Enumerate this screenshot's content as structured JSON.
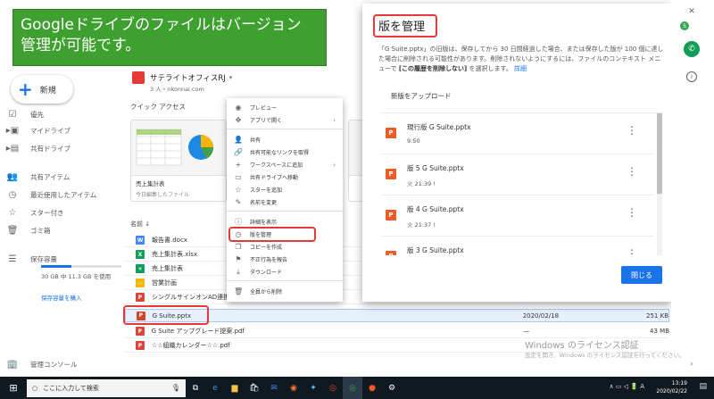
{
  "banner": {
    "line1": "Googleドライブのファイルはバージョン",
    "line2": "管理が可能です。"
  },
  "sidebar": {
    "new_label": "新規",
    "items": [
      {
        "icon": "checkbox-icon",
        "label": "優先"
      },
      {
        "icon": "drive-icon",
        "label": "マイドライブ"
      },
      {
        "icon": "shared-drive-icon",
        "label": "共有ドライブ"
      },
      {
        "icon": "people-icon",
        "label": "共有アイテム"
      },
      {
        "icon": "clock-icon",
        "label": "最近使用したアイテム"
      },
      {
        "icon": "star-icon",
        "label": "スター付き"
      },
      {
        "icon": "trash-icon",
        "label": "ゴミ箱"
      }
    ],
    "storage_label": "保存容量",
    "storage_text": "30 GB 中 11.3 GB を使用",
    "storage_fraction": 0.377,
    "storage_link": "保存容量を購入",
    "admin_label": "管理コンソール"
  },
  "main": {
    "project_name": "サテライトオフィスRJ",
    "project_sub": "3 人・nkonnai.com",
    "quick_access": "クイック アクセス",
    "qa_cards": [
      {
        "name": "売上集計表",
        "sub": "今日編集したファイル"
      }
    ],
    "name_header": "名前 ↓",
    "files": [
      {
        "type": "doc",
        "name": "報告書.docx",
        "date": "",
        "size": ""
      },
      {
        "type": "sheet",
        "name": "売上集計表.xlsx",
        "date": "",
        "size": ""
      },
      {
        "type": "sheet",
        "name": "売上集計表",
        "date": "",
        "size": ""
      },
      {
        "type": "slide",
        "name": "営業計画",
        "date": "",
        "size": ""
      },
      {
        "type": "pdf",
        "name": "シングルサインオンAD連携",
        "date": "",
        "size": ""
      },
      {
        "type": "ppt",
        "name": "G Suite.pptx",
        "date": "2020/02/18",
        "size": "251 KB"
      },
      {
        "type": "pdf",
        "name": "G Suite アップグレード提案.pdf",
        "date": "—",
        "size": "43 MB"
      },
      {
        "type": "pdf",
        "name": "☆☆組織カレンダー☆☆.pdf",
        "date": "",
        "size": ""
      }
    ]
  },
  "context_menu": {
    "items": [
      {
        "icon": "eye-icon",
        "label": "プレビュー",
        "submenu": false
      },
      {
        "icon": "open-with-icon",
        "label": "アプリで開く",
        "submenu": true
      },
      {
        "icon": "share-icon",
        "label": "共有",
        "submenu": false
      },
      {
        "icon": "link-icon",
        "label": "共有可能なリンクを取得",
        "submenu": false
      },
      {
        "icon": "plus-icon",
        "label": "ワークスペースに追加",
        "submenu": true
      },
      {
        "icon": "move-icon",
        "label": "共有ドライブへ移動",
        "submenu": false
      },
      {
        "icon": "star-icon",
        "label": "スターを追加",
        "submenu": false
      },
      {
        "icon": "pencil-icon",
        "label": "名前を変更",
        "submenu": false
      },
      {
        "icon": "info-icon",
        "label": "詳細を表示",
        "submenu": false
      },
      {
        "icon": "history-icon",
        "label": "版を管理",
        "submenu": false
      },
      {
        "icon": "copy-icon",
        "label": "コピーを作成",
        "submenu": false
      },
      {
        "icon": "flag-icon",
        "label": "不正行為を報告",
        "submenu": false
      },
      {
        "icon": "download-icon",
        "label": "ダウンロード",
        "submenu": false
      },
      {
        "icon": "trash-icon",
        "label": "全員から削除",
        "submenu": false
      }
    ]
  },
  "version_panel": {
    "title": "版を管理",
    "desc_1": "「G Suite.pptx」の旧版は、保存してから 30 日間経過した場合、または保存した版が 100 個に達した場合に削除される可能性があります。削除されないようにするには、ファイルのコンテキスト メニューで",
    "desc_bold": "[この履歴を削除しない]",
    "desc_2": "を選択します。",
    "desc_link": "詳細",
    "upload_label": "新版をアップロード",
    "versions": [
      {
        "label": "現行版  G Suite.pptx",
        "time": "9:50"
      },
      {
        "label": "版 5  G Suite.pptx",
        "time": "火 21:39  !"
      },
      {
        "label": "版 4  G Suite.pptx",
        "time": "火 21:37  !"
      },
      {
        "label": "版 3  G Suite.pptx",
        "time": ""
      }
    ],
    "close_label": "閉じる"
  },
  "watermark": {
    "line1": "Windows のライセンス認証",
    "line2": "設定を開き、Windows のライセンス認証を行ってください。"
  },
  "taskbar": {
    "search_placeholder": "ここに入力して検索",
    "time": "13:19",
    "date": "2020/02/22",
    "tray": "∧ ▭ ◁ 🔋 A"
  },
  "colors": {
    "accent": "#1a73e8",
    "banner": "#3ea02f",
    "highlight": "#e53935",
    "ppt": "#ef5b25"
  }
}
